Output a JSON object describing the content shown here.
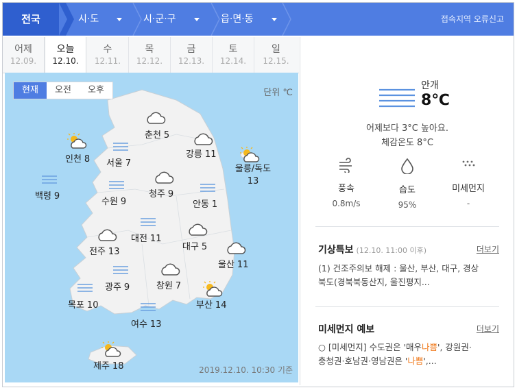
{
  "nav": {
    "national": "전국",
    "sido": "시·도",
    "sigungu": "시·군·구",
    "eupmyeondong": "읍·면·동",
    "report": "접속지역 오류신고"
  },
  "days": [
    {
      "label": "어제",
      "date": "12.09."
    },
    {
      "label": "오늘",
      "date": "12.10."
    },
    {
      "label": "수",
      "date": "12.11."
    },
    {
      "label": "목",
      "date": "12.12."
    },
    {
      "label": "금",
      "date": "12.13."
    },
    {
      "label": "토",
      "date": "12.14."
    },
    {
      "label": "일",
      "date": "12.15."
    }
  ],
  "map": {
    "time_buttons": [
      "현재",
      "오전",
      "오후"
    ],
    "unit": "단위 ℃",
    "basis": "2019.12.10. 10:30 기준",
    "cities": [
      {
        "name": "춘천",
        "temp": "5",
        "icon": "cloud-icon"
      },
      {
        "name": "인천",
        "temp": "8",
        "icon": "sun-cloud-icon"
      },
      {
        "name": "서울",
        "temp": "7",
        "icon": "fog-icon"
      },
      {
        "name": "강릉",
        "temp": "11",
        "icon": "cloud-icon"
      },
      {
        "name": "울릉/독도",
        "temp": "13",
        "icon": "sun-cloud-icon"
      },
      {
        "name": "백령",
        "temp": "9",
        "icon": "fog-icon"
      },
      {
        "name": "수원",
        "temp": "9",
        "icon": "fog-icon"
      },
      {
        "name": "청주",
        "temp": "9",
        "icon": "cloud-icon"
      },
      {
        "name": "안동",
        "temp": "1",
        "icon": "fog-icon"
      },
      {
        "name": "대전",
        "temp": "11",
        "icon": "fog-icon"
      },
      {
        "name": "대구",
        "temp": "5",
        "icon": "cloud-icon"
      },
      {
        "name": "전주",
        "temp": "13",
        "icon": "cloud-icon"
      },
      {
        "name": "울산",
        "temp": "11",
        "icon": "cloud-icon"
      },
      {
        "name": "광주",
        "temp": "9",
        "icon": "fog-icon"
      },
      {
        "name": "창원",
        "temp": "7",
        "icon": "cloud-icon"
      },
      {
        "name": "목포",
        "temp": "10",
        "icon": "fog-icon"
      },
      {
        "name": "부산",
        "temp": "14",
        "icon": "sun-cloud-icon"
      },
      {
        "name": "여수",
        "temp": "13",
        "icon": "fog-icon"
      },
      {
        "name": "제주",
        "temp": "18",
        "icon": "sun-cloud-icon"
      }
    ]
  },
  "current": {
    "condition": "안개",
    "temp": "8℃",
    "diff": "어제보다 3°C 높아요.",
    "feels": "체감온도 8°C",
    "stats": [
      {
        "label": "풍속",
        "value": "0.8m/s",
        "icon": "wind-icon"
      },
      {
        "label": "습도",
        "value": "95%",
        "icon": "drop-icon"
      },
      {
        "label": "미세먼지",
        "value": "-",
        "icon": "dust-icon"
      }
    ]
  },
  "warning": {
    "title": "기상특보",
    "time": "(12.10. 11:00 이후)",
    "more": "더보기",
    "line1": "(1) 건조주의보 해제 : 울산, 부산, 대구, 경상",
    "line2": "북도(경북북동산지, 울진평지..."
  },
  "dust": {
    "title": "미세먼지 예보",
    "more": "더보기",
    "l1a": "○ [미세먼지] 수도권은 '매우",
    "l1b": "나쁨",
    "l1c": "', 강원권·",
    "l2a": "충청권·호남권·영남권은 '",
    "l2b": "나쁨",
    "l2c": "',..."
  },
  "colors": {
    "accent": "#4f7de2",
    "sea": "#a9d8f5",
    "land": "#f4f4f4",
    "orange": "#f07a1c"
  }
}
